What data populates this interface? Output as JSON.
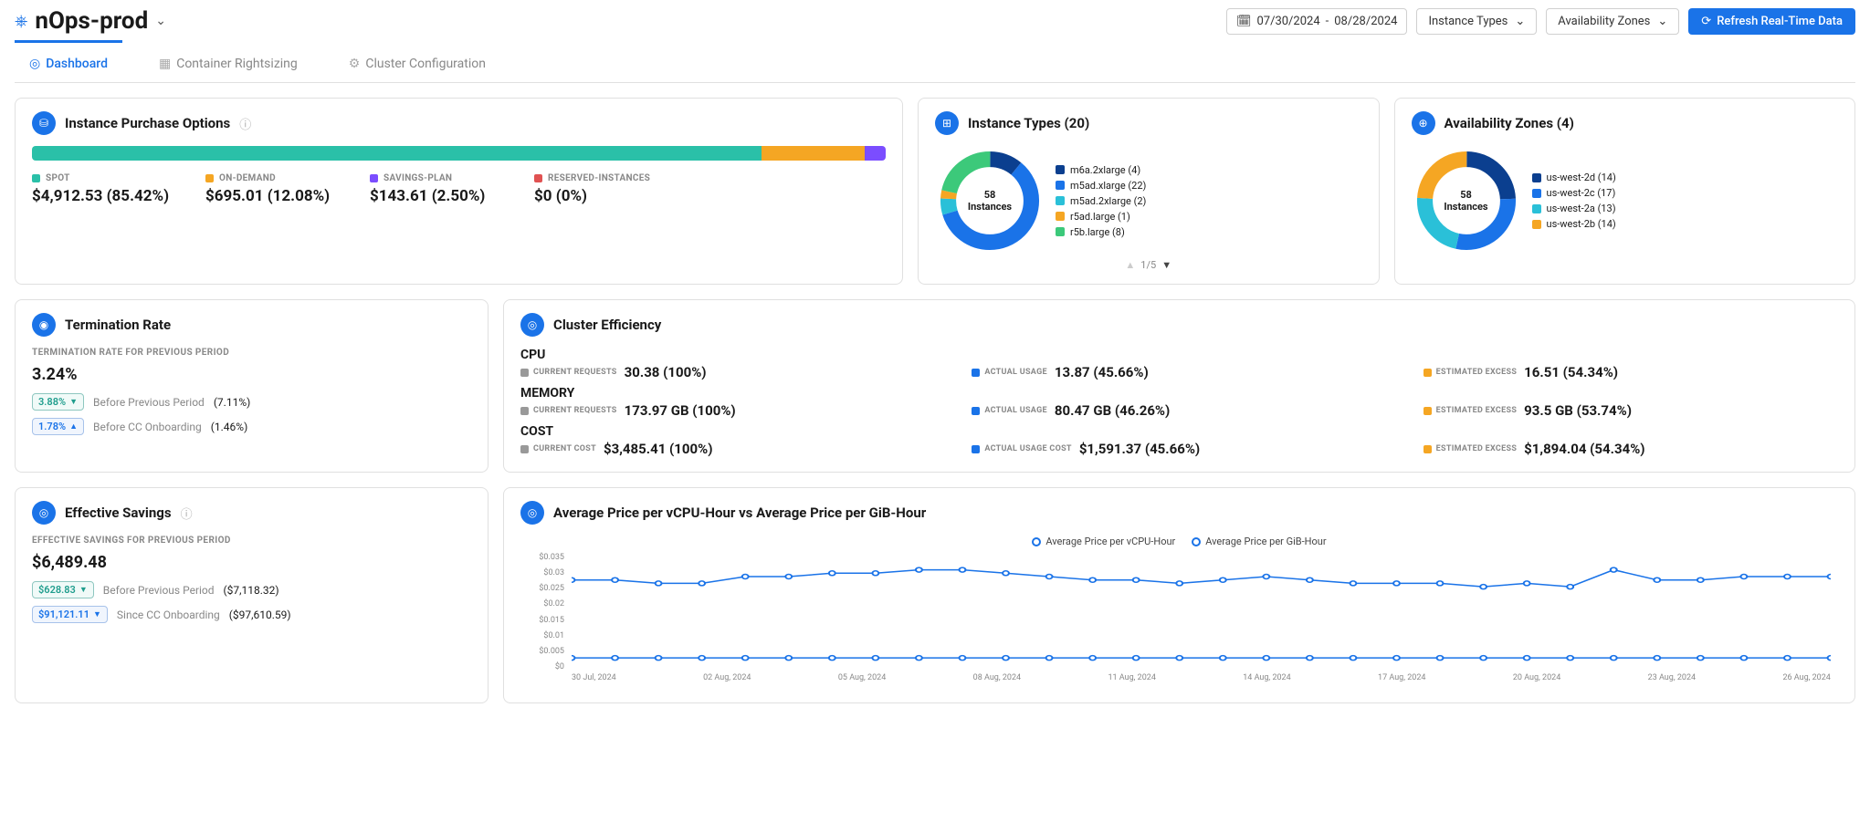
{
  "header": {
    "cluster_name": "nOps-prod",
    "date_from": "07/30/2024",
    "date_to": "08/28/2024",
    "instance_types_label": "Instance Types",
    "az_label": "Availability Zones",
    "refresh_label": "Refresh Real-Time Data"
  },
  "tabs": {
    "dashboard": "Dashboard",
    "container_rightsizing": "Container Rightsizing",
    "cluster_configuration": "Cluster Configuration"
  },
  "purchase_options": {
    "title": "Instance Purchase Options",
    "spot": {
      "label": "SPOT",
      "value": "$4,912.53 (85.42%)",
      "color": "#2ac0a8",
      "pct": 85.42
    },
    "on_demand": {
      "label": "ON-DEMAND",
      "value": "$695.01 (12.08%)",
      "color": "#f5a623",
      "pct": 12.08
    },
    "savings_plan": {
      "label": "SAVINGS-PLAN",
      "value": "$143.61 (2.50%)",
      "color": "#7b4dff",
      "pct": 2.5
    },
    "reserved": {
      "label": "RESERVED-INSTANCES",
      "value": "$0 (0%)",
      "color": "#e05252",
      "pct": 0
    }
  },
  "instance_types": {
    "title": "Instance Types (20)",
    "center": "58 Instances",
    "pager": "1/5",
    "items": [
      {
        "label": "m6a.2xlarge (4)",
        "color": "#0b3f8f"
      },
      {
        "label": "m5ad.xlarge (22)",
        "color": "#1a73e8"
      },
      {
        "label": "m5ad.2xlarge (2)",
        "color": "#2ac0d8"
      },
      {
        "label": "r5ad.large (1)",
        "color": "#f5a623"
      },
      {
        "label": "r5b.large (8)",
        "color": "#3cc97a"
      }
    ]
  },
  "availability_zones": {
    "title": "Availability Zones (4)",
    "center": "58 Instances",
    "items": [
      {
        "label": "us-west-2d (14)",
        "color": "#0b3f8f"
      },
      {
        "label": "us-west-2c (17)",
        "color": "#1a73e8"
      },
      {
        "label": "us-west-2a (13)",
        "color": "#2ac0d8"
      },
      {
        "label": "us-west-2b (14)",
        "color": "#f5a623"
      }
    ]
  },
  "termination": {
    "title": "Termination Rate",
    "sub": "TERMINATION RATE FOR PREVIOUS PERIOD",
    "value": "3.24%",
    "line1_pill": "3.88%",
    "line1_text": "Before Previous Period",
    "line1_paren": "(7.11%)",
    "line2_pill": "1.78%",
    "line2_text": "Before CC Onboarding",
    "line2_paren": "(1.46%)"
  },
  "savings": {
    "title": "Effective Savings",
    "sub": "EFFECTIVE SAVINGS FOR PREVIOUS PERIOD",
    "value": "$6,489.48",
    "line1_pill": "$628.83",
    "line1_text": "Before Previous Period",
    "line1_paren": "($7,118.32)",
    "line2_pill": "$91,121.11",
    "line2_text": "Since CC Onboarding",
    "line2_paren": "($97,610.59)"
  },
  "efficiency": {
    "title": "Cluster Efficiency",
    "cpu_title": "CPU",
    "cpu_req_label": "CURRENT REQUESTS",
    "cpu_req_val": "30.38 (100%)",
    "cpu_usage_label": "ACTUAL USAGE",
    "cpu_usage_val": "13.87 (45.66%)",
    "cpu_excess_label": "ESTIMATED EXCESS",
    "cpu_excess_val": "16.51 (54.34%)",
    "mem_title": "MEMORY",
    "mem_req_val": "173.97 GB (100%)",
    "mem_usage_val": "80.47 GB (46.26%)",
    "mem_excess_val": "93.5 GB (53.74%)",
    "cost_title": "COST",
    "cost_req_label": "CURRENT COST",
    "cost_req_val": "$3,485.41 (100%)",
    "cost_usage_label": "ACTUAL USAGE COST",
    "cost_usage_val": "$1,591.37 (45.66%)",
    "cost_excess_val": "$1,894.04 (54.34%)"
  },
  "price_chart": {
    "title": "Average Price per vCPU-Hour vs Average Price per GiB-Hour",
    "series1": "Average Price per vCPU-Hour",
    "series2": "Average Price per GiB-Hour",
    "y_ticks": [
      "$0.035",
      "$0.03",
      "$0.025",
      "$0.02",
      "$0.015",
      "$0.01",
      "$0.005",
      "$0"
    ],
    "x_ticks": [
      "30 Jul, 2024",
      "02 Aug, 2024",
      "05 Aug, 2024",
      "08 Aug, 2024",
      "11 Aug, 2024",
      "14 Aug, 2024",
      "17 Aug, 2024",
      "20 Aug, 2024",
      "23 Aug, 2024",
      "26 Aug, 2024"
    ]
  },
  "chart_data": [
    {
      "type": "bar",
      "title": "Instance Purchase Options",
      "categories": [
        "SPOT",
        "ON-DEMAND",
        "SAVINGS-PLAN",
        "RESERVED-INSTANCES"
      ],
      "values_usd": [
        4912.53,
        695.01,
        143.61,
        0
      ],
      "values_pct": [
        85.42,
        12.08,
        2.5,
        0
      ]
    },
    {
      "type": "pie",
      "title": "Instance Types",
      "total": 58,
      "series": [
        {
          "name": "m6a.2xlarge",
          "value": 4
        },
        {
          "name": "m5ad.xlarge",
          "value": 22
        },
        {
          "name": "m5ad.2xlarge",
          "value": 2
        },
        {
          "name": "r5ad.large",
          "value": 1
        },
        {
          "name": "r5b.large",
          "value": 8
        }
      ]
    },
    {
      "type": "pie",
      "title": "Availability Zones",
      "total": 58,
      "series": [
        {
          "name": "us-west-2d",
          "value": 14
        },
        {
          "name": "us-west-2c",
          "value": 17
        },
        {
          "name": "us-west-2a",
          "value": 13
        },
        {
          "name": "us-west-2b",
          "value": 14
        }
      ]
    },
    {
      "type": "line",
      "title": "Average Price per vCPU-Hour vs Average Price per GiB-Hour",
      "x": [
        "30 Jul",
        "31 Jul",
        "01 Aug",
        "02 Aug",
        "03 Aug",
        "04 Aug",
        "05 Aug",
        "06 Aug",
        "07 Aug",
        "08 Aug",
        "09 Aug",
        "10 Aug",
        "11 Aug",
        "12 Aug",
        "13 Aug",
        "14 Aug",
        "15 Aug",
        "16 Aug",
        "17 Aug",
        "18 Aug",
        "19 Aug",
        "20 Aug",
        "21 Aug",
        "22 Aug",
        "23 Aug",
        "24 Aug",
        "25 Aug",
        "26 Aug",
        "27 Aug",
        "28 Aug"
      ],
      "ylim": [
        0,
        0.035
      ],
      "series": [
        {
          "name": "Average Price per vCPU-Hour",
          "values": [
            0.027,
            0.027,
            0.026,
            0.026,
            0.028,
            0.028,
            0.029,
            0.029,
            0.03,
            0.03,
            0.029,
            0.028,
            0.027,
            0.027,
            0.026,
            0.027,
            0.028,
            0.027,
            0.026,
            0.026,
            0.026,
            0.025,
            0.026,
            0.025,
            0.03,
            0.027,
            0.027,
            0.028,
            0.028,
            0.028
          ]
        },
        {
          "name": "Average Price per GiB-Hour",
          "values": [
            0.004,
            0.004,
            0.004,
            0.004,
            0.004,
            0.004,
            0.004,
            0.004,
            0.004,
            0.004,
            0.004,
            0.004,
            0.004,
            0.004,
            0.004,
            0.004,
            0.004,
            0.004,
            0.004,
            0.004,
            0.004,
            0.004,
            0.004,
            0.004,
            0.004,
            0.004,
            0.004,
            0.004,
            0.004,
            0.004
          ]
        }
      ]
    }
  ]
}
